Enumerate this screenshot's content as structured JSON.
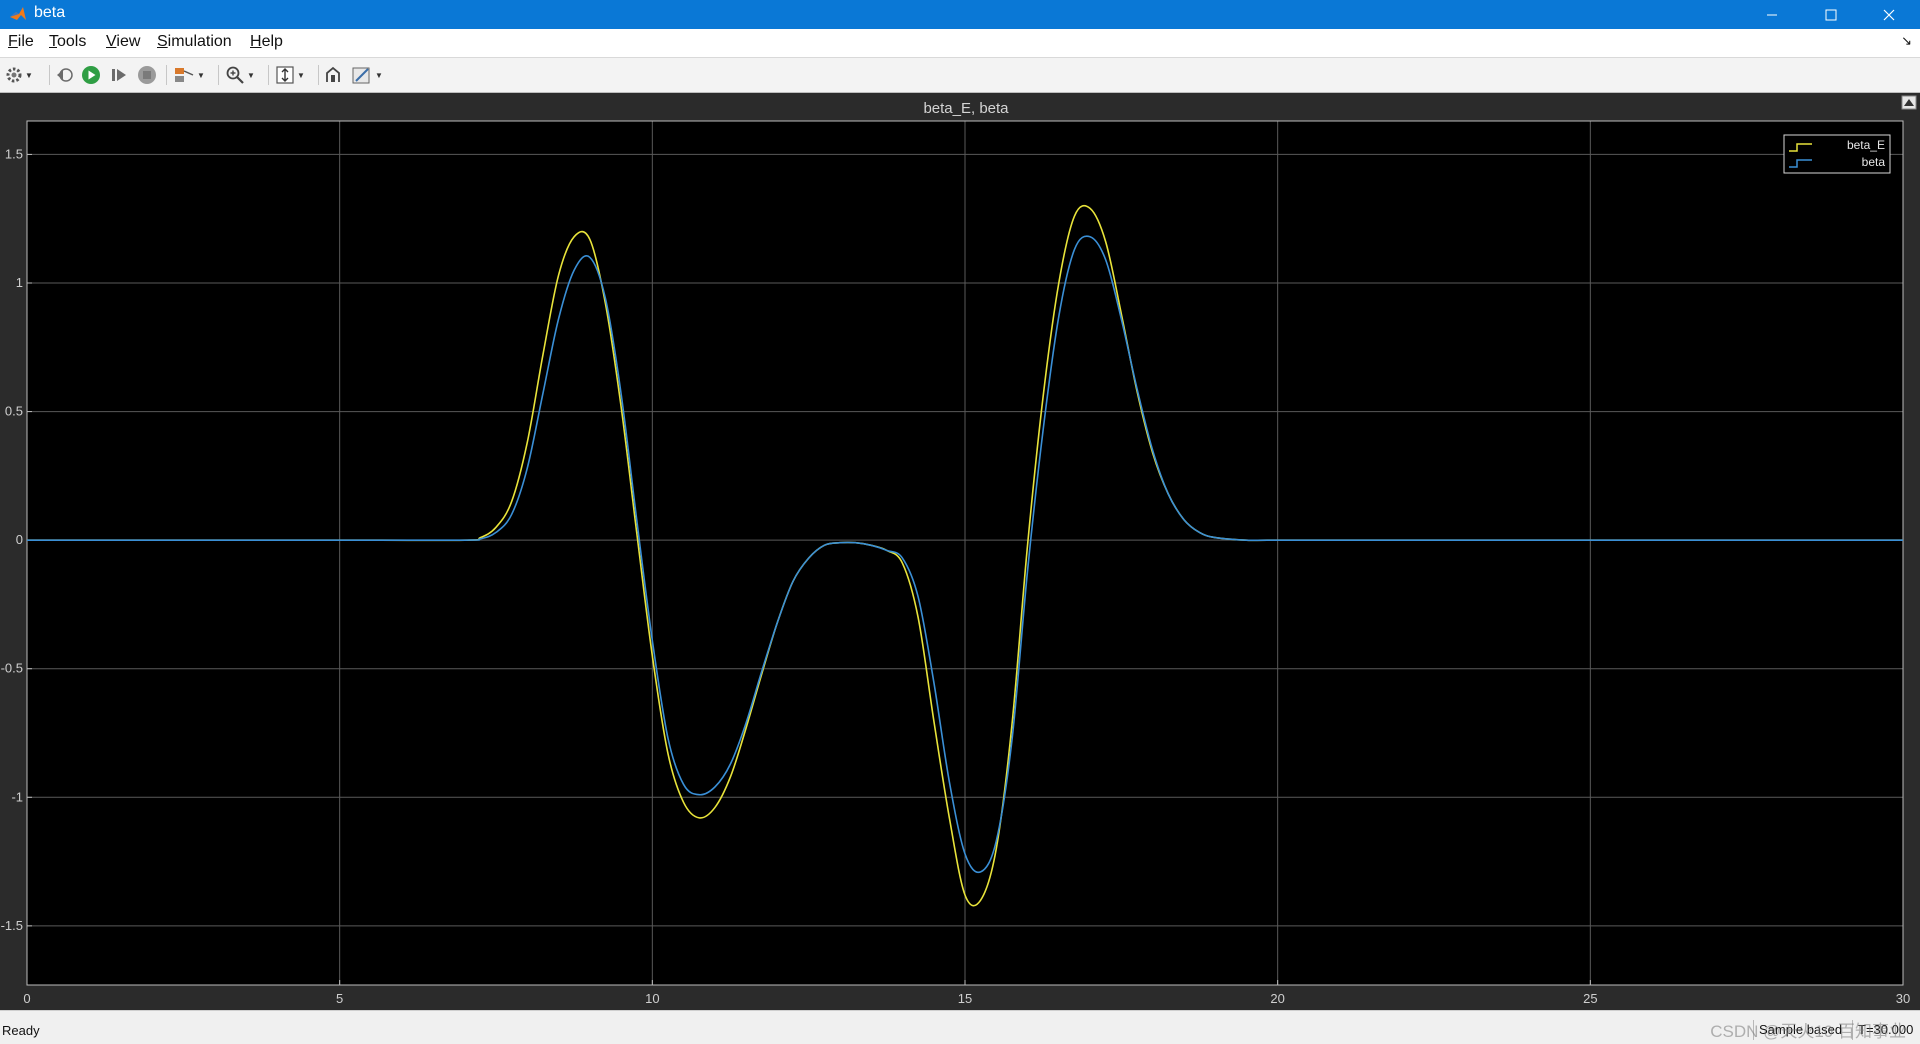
{
  "window": {
    "title": "beta",
    "app_icon": "matlab-logo-icon"
  },
  "window_controls": [
    "minimize-icon",
    "maximize-icon",
    "close-icon"
  ],
  "menu": [
    "File",
    "Tools",
    "View",
    "Simulation",
    "Help"
  ],
  "toolbar": [
    "settings-gear-icon",
    "step-back-icon",
    "run-icon",
    "step-forward-icon",
    "stop-icon",
    "signal-select-icon",
    "zoom-in-icon",
    "autoscale-icon",
    "highlight-block-icon",
    "style-edit-icon"
  ],
  "status": {
    "ready": "Ready",
    "mode": "Sample based",
    "time": "T=30.000",
    "watermark": "CSDN @天火10 百知事业"
  },
  "colors": {
    "beta_E": "#e8e33a",
    "beta": "#3a8fd6",
    "plot_bg": "#000000",
    "frame_bg": "#2b2b2b"
  },
  "chart_data": {
    "type": "line",
    "title": "beta_E, beta",
    "xlim": [
      0,
      30
    ],
    "ylim": [
      -1.73,
      1.63
    ],
    "xticks": [
      0,
      5,
      10,
      15,
      20,
      25,
      30
    ],
    "yticks": [
      -1.5,
      -1,
      -0.5,
      0,
      0.5,
      1,
      1.5
    ],
    "ytick_labels": [
      "-1.5",
      "-1",
      "-0.5",
      "0",
      "0.5",
      "1",
      "1.5"
    ],
    "grid": true,
    "legend_position": "top-right",
    "x": [
      0,
      5,
      7,
      7.25,
      7.5,
      7.75,
      8,
      8.25,
      8.5,
      8.75,
      9,
      9.25,
      9.5,
      9.75,
      10,
      10.25,
      10.5,
      10.75,
      11,
      11.25,
      11.5,
      11.75,
      12,
      12.25,
      12.5,
      12.75,
      13,
      13.25,
      13.5,
      13.75,
      14,
      14.25,
      14.5,
      14.75,
      15,
      15.25,
      15.5,
      15.75,
      16,
      16.25,
      16.5,
      16.75,
      17,
      17.25,
      17.5,
      17.75,
      18,
      18.25,
      18.5,
      18.75,
      19,
      19.5,
      20,
      20.5,
      25,
      30
    ],
    "series": [
      {
        "name": "beta_E",
        "values": [
          0,
          0,
          0,
          0.01,
          0.05,
          0.15,
          0.38,
          0.72,
          1.03,
          1.18,
          1.17,
          0.92,
          0.52,
          0.03,
          -0.45,
          -0.83,
          -1.02,
          -1.08,
          -1.04,
          -0.92,
          -0.73,
          -0.52,
          -0.32,
          -0.16,
          -0.07,
          -0.02,
          -0.01,
          -0.01,
          -0.02,
          -0.04,
          -0.09,
          -0.3,
          -0.7,
          -1.08,
          -1.38,
          -1.4,
          -1.2,
          -0.72,
          -0.02,
          0.56,
          1.0,
          1.26,
          1.29,
          1.16,
          0.88,
          0.58,
          0.34,
          0.18,
          0.08,
          0.03,
          0.01,
          0,
          0,
          0,
          0,
          0
        ]
      },
      {
        "name": "beta",
        "values": [
          0,
          0,
          0,
          0.005,
          0.03,
          0.1,
          0.28,
          0.57,
          0.86,
          1.05,
          1.1,
          0.94,
          0.57,
          0.08,
          -0.39,
          -0.77,
          -0.95,
          -0.99,
          -0.96,
          -0.87,
          -0.71,
          -0.51,
          -0.32,
          -0.16,
          -0.07,
          -0.02,
          -0.01,
          -0.01,
          -0.02,
          -0.04,
          -0.07,
          -0.22,
          -0.55,
          -0.94,
          -1.22,
          -1.29,
          -1.17,
          -0.78,
          -0.12,
          0.43,
          0.87,
          1.13,
          1.18,
          1.09,
          0.86,
          0.59,
          0.35,
          0.18,
          0.08,
          0.03,
          0.01,
          0,
          0,
          0,
          0,
          0
        ]
      }
    ]
  }
}
